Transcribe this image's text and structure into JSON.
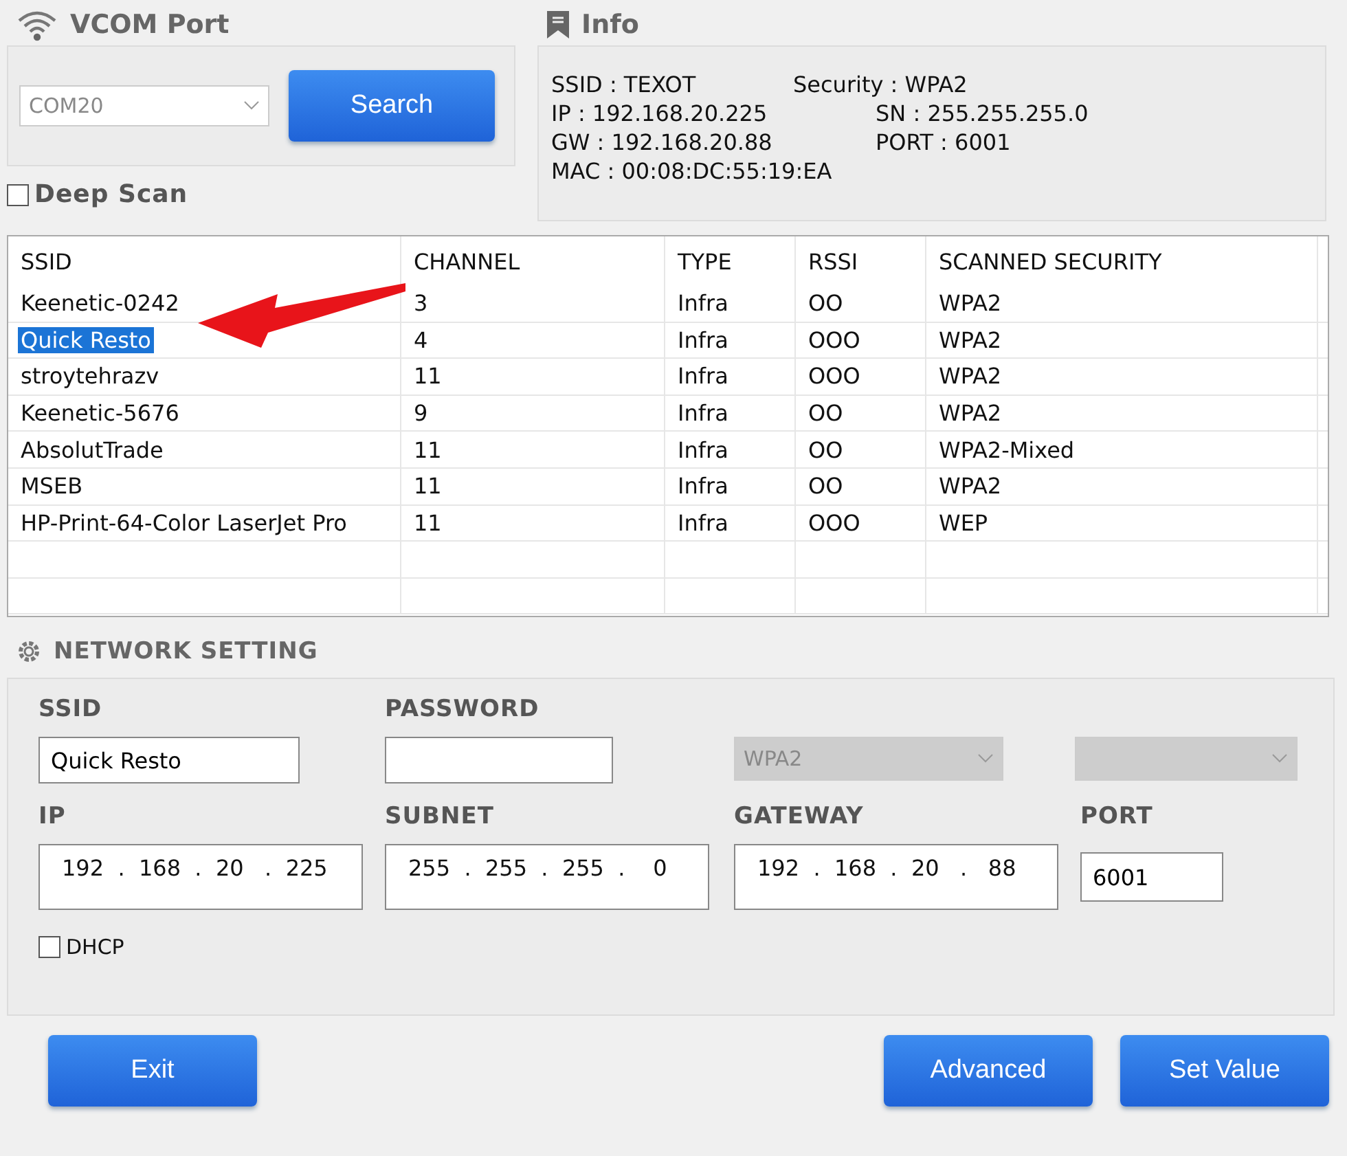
{
  "vcom": {
    "title": "VCOM Port",
    "port": {
      "value": "COM20",
      "disabled": true
    },
    "search_button": "Search",
    "deep_scan": {
      "label": "Deep Scan",
      "checked": false
    }
  },
  "info": {
    "title": "Info",
    "lines": [
      {
        "left": "SSID : TEXOT",
        "right": "Security : WPA2"
      },
      {
        "left": "IP : 192.168.20.225",
        "right": "SN : 255.255.255.0"
      },
      {
        "left": "GW : 192.168.20.88",
        "right": "PORT : 6001"
      },
      {
        "left": "MAC : 00:08:DC:55:19:EA"
      }
    ]
  },
  "table": {
    "columns": [
      "SSID",
      "CHANNEL",
      "TYPE",
      "RSSI",
      "SCANNED SECURITY"
    ],
    "rows": [
      {
        "cells": [
          "Keenetic-0242",
          "3",
          "Infra",
          "OO",
          "WPA2"
        ],
        "selected": false
      },
      {
        "cells": [
          "Quick Resto",
          "4",
          "Infra",
          "OOO",
          "WPA2"
        ],
        "selected": true
      },
      {
        "cells": [
          "stroytehrazv",
          "11",
          "Infra",
          "OOO",
          "WPA2"
        ],
        "selected": false
      },
      {
        "cells": [
          "Keenetic-5676",
          "9",
          "Infra",
          "OO",
          "WPA2"
        ],
        "selected": false
      },
      {
        "cells": [
          "AbsolutTrade",
          "11",
          "Infra",
          "OO",
          "WPA2-Mixed"
        ],
        "selected": false
      },
      {
        "cells": [
          "MSEB",
          "11",
          "Infra",
          "OO",
          "WPA2"
        ],
        "selected": false
      },
      {
        "cells": [
          "HP-Print-64-Color LaserJet Pro",
          "11",
          "Infra",
          "OOO",
          "WEP"
        ],
        "selected": false
      }
    ]
  },
  "network_setting": {
    "title": "NETWORK SETTING",
    "ssid": {
      "label": "SSID",
      "value": "Quick Resto"
    },
    "password": {
      "label": "PASSWORD"
    },
    "security_select": {
      "value": "WPA2",
      "disabled": true
    },
    "encryption_select": {
      "disabled": true
    },
    "ip": {
      "label": "IP",
      "value": "192  .  168  .  20   .  225"
    },
    "subnet": {
      "label": "SUBNET",
      "value": "255  .  255  .  255  .    0"
    },
    "gateway": {
      "label": "GATEWAY",
      "value": "192  .  168  .  20   .   88"
    },
    "port": {
      "label": "PORT",
      "value": "6001"
    },
    "dhcp": {
      "label": "DHCP",
      "checked": false
    }
  },
  "buttons": {
    "exit": "Exit",
    "advanced": "Advanced",
    "set_value": "Set Value"
  }
}
